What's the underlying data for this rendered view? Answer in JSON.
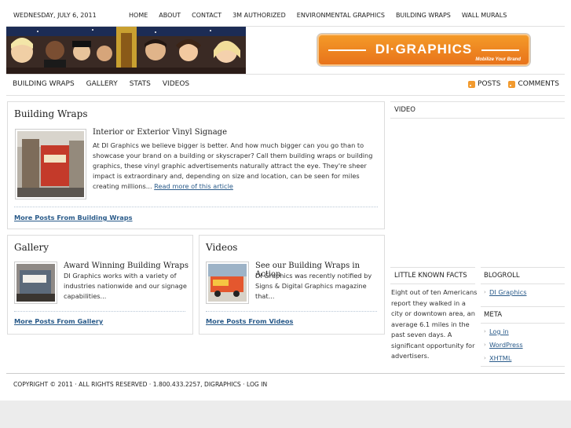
{
  "header": {
    "date": "WEDNESDAY, JULY 6, 2011",
    "top_nav": [
      "HOME",
      "ABOUT",
      "CONTACT",
      "3M AUTHORIZED",
      "ENVIRONMENTAL GRAPHICS",
      "BUILDING WRAPS",
      "WALL MURALS"
    ]
  },
  "logo": {
    "name": "DI·GRAPHICS",
    "tagline": "Mobilize Your Brand",
    "color": "#ef8a22"
  },
  "main_nav": {
    "items": [
      "BUILDING WRAPS",
      "GALLERY",
      "STATS",
      "VIDEOS"
    ],
    "posts_label": "POSTS",
    "comments_label": "COMMENTS"
  },
  "building_wraps": {
    "heading": "Building Wraps",
    "post_title": "Interior or Exterior Vinyl Signage",
    "post_text": "At DI Graphics we believe bigger is better. And how much bigger can you go than to showcase your brand on a building or skyscraper? Call them building wraps or building graphics, these vinyl graphic advertisements naturally attract the eye. They're sheer impact is extraordinary and, depending on size and location, can be seen for miles creating millions...",
    "read_more": "Read more of this article",
    "more_link": "More Posts From Building Wraps"
  },
  "gallery": {
    "heading": "Gallery",
    "post_title": "Award Winning Building Wraps",
    "post_text": "DI Graphics works with a variety of industries nationwide and our signage capabilities...",
    "more_link": "More Posts From Gallery"
  },
  "videos": {
    "heading": "Videos",
    "post_title": "See our Building Wraps in Action",
    "post_text": "DI Graphics was recently notified by Signs & Digital Graphics magazine that...",
    "more_link": "More Posts From Videos"
  },
  "sidebar": {
    "video_heading": "VIDEO",
    "facts_heading": "LITTLE KNOWN FACTS",
    "facts_text": "Eight out of ten Americans report they walked in a city or downtown area, an average 6.1 miles in the past seven days. A significant opportunity for advertisers.",
    "blogroll_heading": "BLOGROLL",
    "blogroll_links": [
      "DI Graphics"
    ],
    "meta_heading": "META",
    "meta_links": [
      "Log in",
      "WordPress",
      "XHTML"
    ]
  },
  "footer": {
    "text": "COPYRIGHT © 2011 · ALL RIGHTS RESERVED · 1.800.433.2257, DIGRAPHICS · LOG IN"
  }
}
